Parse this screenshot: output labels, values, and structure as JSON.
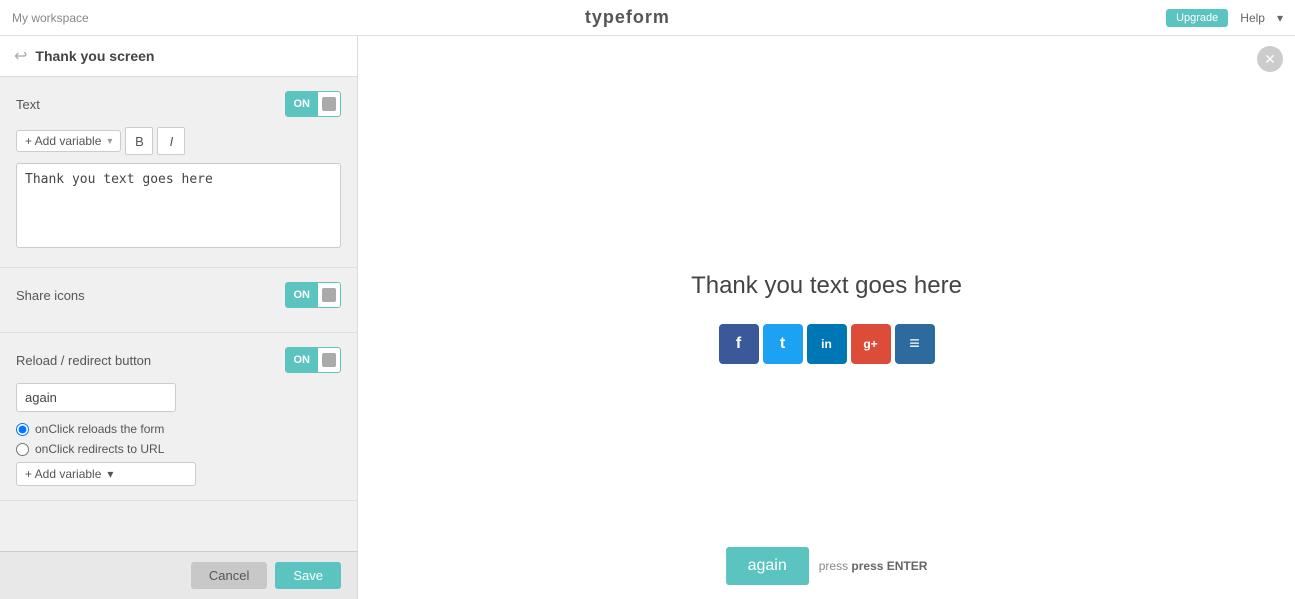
{
  "topbar": {
    "left_label": "My workspace",
    "center_label": "typeform",
    "upgrade_label": "Upgrade",
    "help_label": "Help"
  },
  "panel": {
    "header_title": "Thank you screen",
    "header_icon": "↩",
    "sections": {
      "text": {
        "label": "Text",
        "toggle_state": "ON",
        "add_variable_label": "+ Add variable",
        "bold_label": "B",
        "italic_label": "I",
        "textarea_value": "Thank you text goes here"
      },
      "share_icons": {
        "label": "Share icons",
        "toggle_state": "ON"
      },
      "reload": {
        "label": "Reload / redirect button",
        "toggle_state": "ON",
        "button_value": "again",
        "radio1_label": "onClick reloads the form",
        "radio2_label": "onClick redirects to URL",
        "add_variable_label": "+ Add variable"
      }
    },
    "footer": {
      "cancel_label": "Cancel",
      "save_label": "Save"
    }
  },
  "preview": {
    "title": "Thank you text goes here",
    "social_icons": [
      {
        "name": "facebook",
        "symbol": "f",
        "class": "social-fb"
      },
      {
        "name": "twitter",
        "symbol": "t",
        "class": "social-tw"
      },
      {
        "name": "linkedin",
        "symbol": "in",
        "class": "social-li"
      },
      {
        "name": "google-plus",
        "symbol": "g+",
        "class": "social-gp"
      },
      {
        "name": "buffer",
        "symbol": "≡",
        "class": "social-buf"
      }
    ],
    "again_button_label": "again",
    "press_enter_label": "press ENTER"
  }
}
